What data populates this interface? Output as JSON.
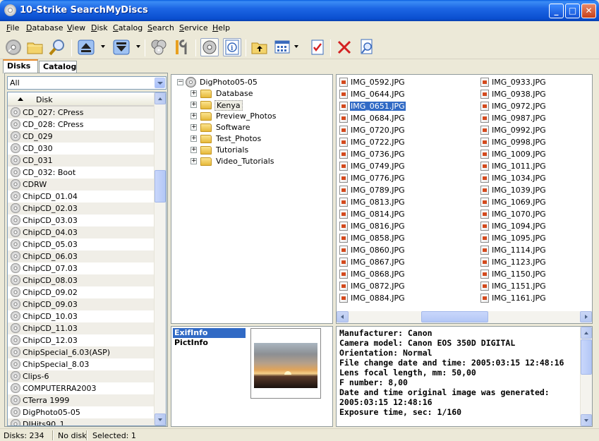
{
  "window": {
    "title": "10-Strike SearchMyDiscs",
    "minimize": "_",
    "maximize": "□",
    "close": "✕"
  },
  "menu": [
    "File",
    "Database",
    "View",
    "Disk",
    "Catalog",
    "Search",
    "Service",
    "Help"
  ],
  "toolbar_icons": [
    "disk-icon",
    "open-folder-icon",
    "search-icon",
    "eject-icon",
    "load-icon",
    "disks-group-icon",
    "tools-icon",
    "cd-view-icon",
    "info-icon",
    "up-folder-icon",
    "view-grid-icon",
    "report-icon",
    "delete-icon",
    "preview-icon"
  ],
  "tabs": {
    "disks": "Disks",
    "catalog": "Catalog"
  },
  "filter": {
    "value": "All"
  },
  "disk_column_header": "Disk",
  "disks": [
    "CD_027: CPress",
    "CD_028: CPress",
    "CD_029",
    "CD_030",
    "CD_031",
    "CD_032: Boot",
    "CDRW",
    "ChipCD_01.04",
    "ChipCD_02.03",
    "ChipCD_03.03",
    "ChipCD_04.03",
    "ChipCD_05.03",
    "ChipCD_06.03",
    "ChipCD_07.03",
    "ChipCD_08.03",
    "ChipCD_09.02",
    "ChipCD_09.03",
    "ChipCD_10.03",
    "ChipCD_11.03",
    "ChipCD_12.03",
    "ChipSpecial_6.03(ASP)",
    "ChipSpecial_8.03",
    "Clips-6",
    "COMPUTERRA2003",
    "CTerra 1999",
    "DigPhoto05-05",
    "DJHits90_1"
  ],
  "tree": {
    "root": "DigPhoto05-05",
    "folders": [
      "Database",
      "Kenya",
      "Preview_Photos",
      "Software",
      "Test_Photos",
      "Tutorials",
      "Video_Tutorials"
    ],
    "selected": "Kenya"
  },
  "files": {
    "column1": [
      "IMG_0592.JPG",
      "IMG_0644.JPG",
      "IMG_0651.JPG",
      "IMG_0684.JPG",
      "IMG_0720.JPG",
      "IMG_0722.JPG",
      "IMG_0736.JPG",
      "IMG_0749.JPG",
      "IMG_0776.JPG",
      "IMG_0789.JPG",
      "IMG_0813.JPG",
      "IMG_0814.JPG",
      "IMG_0816.JPG",
      "IMG_0858.JPG",
      "IMG_0860.JPG",
      "IMG_0867.JPG",
      "IMG_0868.JPG",
      "IMG_0872.JPG",
      "IMG_0884.JPG"
    ],
    "column2": [
      "IMG_0933.JPG",
      "IMG_0938.JPG",
      "IMG_0972.JPG",
      "IMG_0987.JPG",
      "IMG_0992.JPG",
      "IMG_0998.JPG",
      "IMG_1009.JPG",
      "IMG_1011.JPG",
      "IMG_1034.JPG",
      "IMG_1039.JPG",
      "IMG_1069.JPG",
      "IMG_1070.JPG",
      "IMG_1094.JPG",
      "IMG_1095.JPG",
      "IMG_1114.JPG",
      "IMG_1123.JPG",
      "IMG_1150.JPG",
      "IMG_1151.JPG",
      "IMG_1161.JPG"
    ],
    "selected": "IMG_0651.JPG"
  },
  "info_tabs": [
    "ExifInfo",
    "PictInfo"
  ],
  "exif": [
    "Manufacturer: Canon",
    "Camera model: Canon EOS 350D DIGITAL",
    "Orientation: Normal",
    "File change date and time: 2005:03:15 12:48:16",
    "Lens focal length, mm: 50,00",
    "F number: 8,00",
    "Date and time original image was generated:",
    "2005:03:15 12:48:16",
    "Exposure time, sec: 1/160"
  ],
  "status": {
    "disks": "Disks: 234",
    "disk": "No disk",
    "selected": "Selected: 1"
  }
}
